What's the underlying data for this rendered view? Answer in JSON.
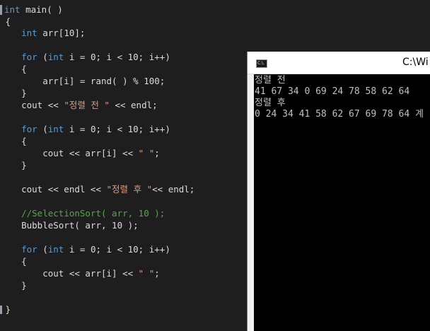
{
  "editor": {
    "lines": {
      "l1": [
        {
          "t": "int",
          "c": "kw"
        },
        {
          "t": " main( )",
          "c": "plain"
        }
      ],
      "l2": [
        {
          "t": " {",
          "c": "plain"
        }
      ],
      "l3": [
        {
          "t": "    ",
          "c": "plain"
        },
        {
          "t": "int",
          "c": "kw"
        },
        {
          "t": " arr[10];",
          "c": "plain"
        }
      ],
      "l4": [
        {
          "t": "    ",
          "c": "plain"
        },
        {
          "t": "for",
          "c": "kw"
        },
        {
          "t": " (",
          "c": "plain"
        },
        {
          "t": "int",
          "c": "kw"
        },
        {
          "t": " i = 0; i < 10; i++)",
          "c": "plain"
        }
      ],
      "l5": [
        {
          "t": "    {",
          "c": "plain"
        }
      ],
      "l6": [
        {
          "t": "        arr[i] = rand( ) % 100;",
          "c": "plain"
        }
      ],
      "l7": [
        {
          "t": "    }",
          "c": "plain"
        }
      ],
      "l8": [
        {
          "t": "    cout << ",
          "c": "plain"
        },
        {
          "t": "\"정렬 전 \"",
          "c": "str"
        },
        {
          "t": " << endl;",
          "c": "plain"
        }
      ],
      "l9": [
        {
          "t": "    ",
          "c": "plain"
        },
        {
          "t": "for",
          "c": "kw"
        },
        {
          "t": " (",
          "c": "plain"
        },
        {
          "t": "int",
          "c": "kw"
        },
        {
          "t": " i = 0; i < 10; i++)",
          "c": "plain"
        }
      ],
      "l10": [
        {
          "t": "    {",
          "c": "plain"
        }
      ],
      "l11": [
        {
          "t": "        cout << arr[i] << ",
          "c": "plain"
        },
        {
          "t": "\" \"",
          "c": "str"
        },
        {
          "t": ";",
          "c": "plain"
        }
      ],
      "l12": [
        {
          "t": "    }",
          "c": "plain"
        }
      ],
      "l13": [
        {
          "t": "    cout << endl << ",
          "c": "plain"
        },
        {
          "t": "\"정렬 후 \"",
          "c": "str"
        },
        {
          "t": "<< endl;",
          "c": "plain"
        }
      ],
      "l14": [
        {
          "t": "    ",
          "c": "plain"
        },
        {
          "t": "//SelectionSort( arr, 10 );",
          "c": "cmt"
        }
      ],
      "l15": [
        {
          "t": "    BubbleSort( arr, 10 );",
          "c": "plain"
        }
      ],
      "l16": [
        {
          "t": "    ",
          "c": "plain"
        },
        {
          "t": "for",
          "c": "kw"
        },
        {
          "t": " (",
          "c": "plain"
        },
        {
          "t": "int",
          "c": "kw"
        },
        {
          "t": " i = 0; i < 10; i++)",
          "c": "plain"
        }
      ],
      "l17": [
        {
          "t": "    {",
          "c": "plain"
        }
      ],
      "l18": [
        {
          "t": "        cout << arr[i] << ",
          "c": "plain"
        },
        {
          "t": "\" \"",
          "c": "str"
        },
        {
          "t": ";",
          "c": "plain"
        }
      ],
      "l19": [
        {
          "t": "    }",
          "c": "plain"
        }
      ],
      "l20": [
        {
          "t": " }",
          "c": "plain"
        }
      ]
    },
    "colors": {
      "background": "#1e1e1e",
      "keyword": "#569cd6",
      "string": "#d69d85",
      "comment": "#57a64a",
      "text": "#dcdcdc"
    }
  },
  "console": {
    "icon_label": "C:\\.",
    "title": "C:\\Wi",
    "output": {
      "o1": "정렬 전",
      "o2": "41 67 34 0 69 24 78 58 62 64",
      "o3": "정렬 후",
      "o4": "0 24 34 41 58 62 67 69 78 64 계"
    }
  }
}
